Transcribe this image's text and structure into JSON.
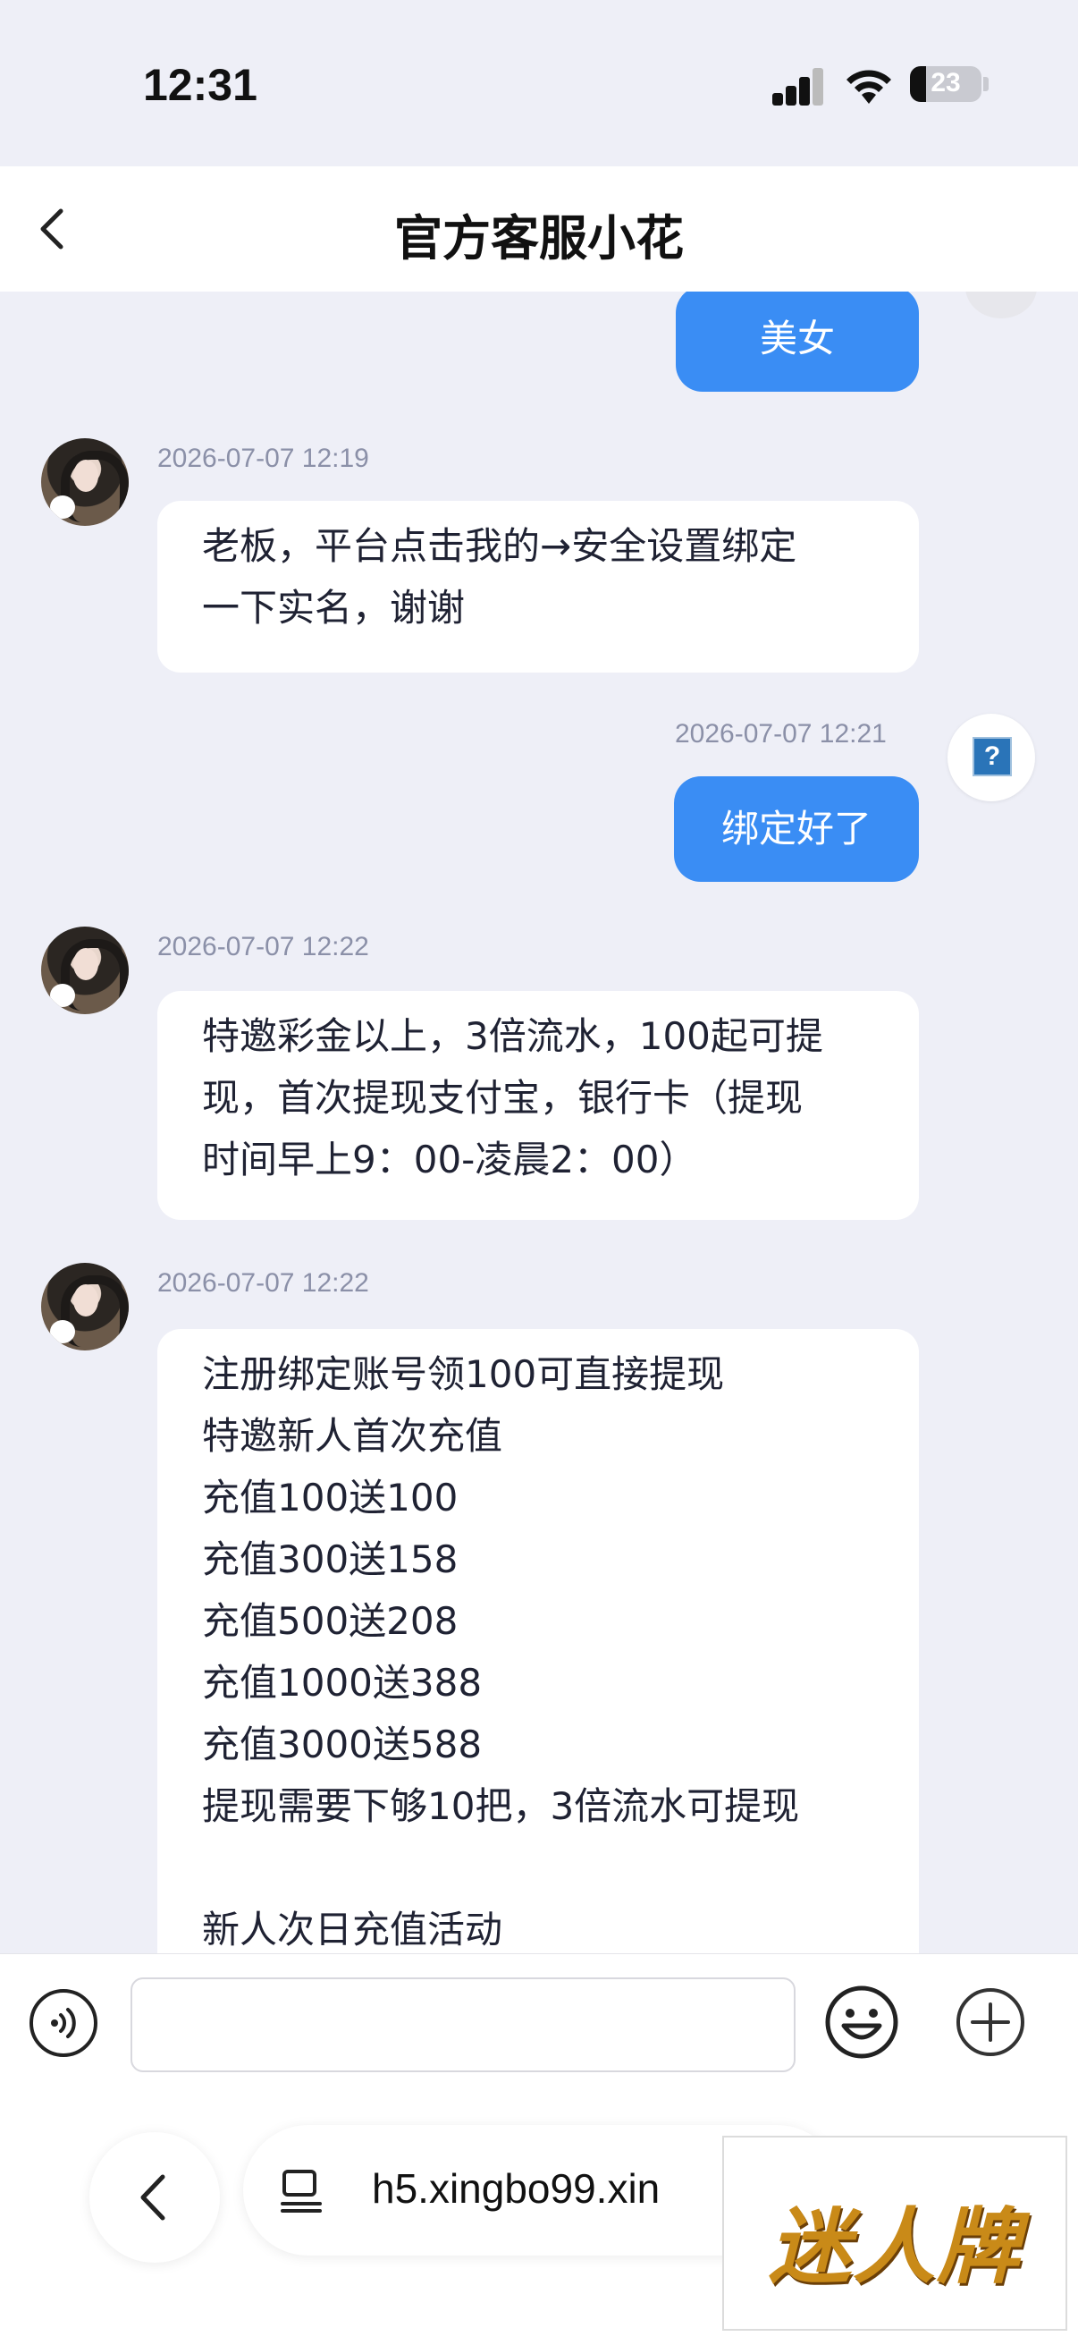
{
  "status_bar": {
    "time": "12:31",
    "battery": "23"
  },
  "header": {
    "title": "官方客服小花"
  },
  "messages": [
    {
      "side": "right",
      "text": "美女"
    },
    {
      "side": "left",
      "timestamp": "2026-07-07 12:19",
      "lines": [
        "老板，平台点击我的→安全设置绑定",
        "一下实名，谢谢"
      ]
    },
    {
      "side": "right",
      "timestamp": "2026-07-07 12:21",
      "text": "绑定好了"
    },
    {
      "side": "left",
      "timestamp": "2026-07-07 12:22",
      "lines": [
        "特邀彩金以上，3倍流水，100起可提",
        "现，首次提现支付宝，银行卡（提现",
        "时间早上9：00-凌晨2：00）"
      ]
    },
    {
      "side": "left",
      "timestamp": "2026-07-07 12:22",
      "lines": [
        "注册绑定账号领100可直接提现",
        "特邀新人首次充值",
        "充值100送100",
        "充值300送158",
        "充值500送208",
        "充值1000送388",
        "充值3000送588",
        "提现需要下够10把，3倍流水可提现",
        "",
        "新人次日充值活动"
      ]
    }
  ],
  "input_bar": {
    "message_value": ""
  },
  "browser": {
    "url": "h5.xingbo99.xin"
  },
  "watermark": {
    "text": "迷人牌"
  },
  "colors": {
    "accent": "#3a8df4",
    "background": "#eeeff7"
  }
}
